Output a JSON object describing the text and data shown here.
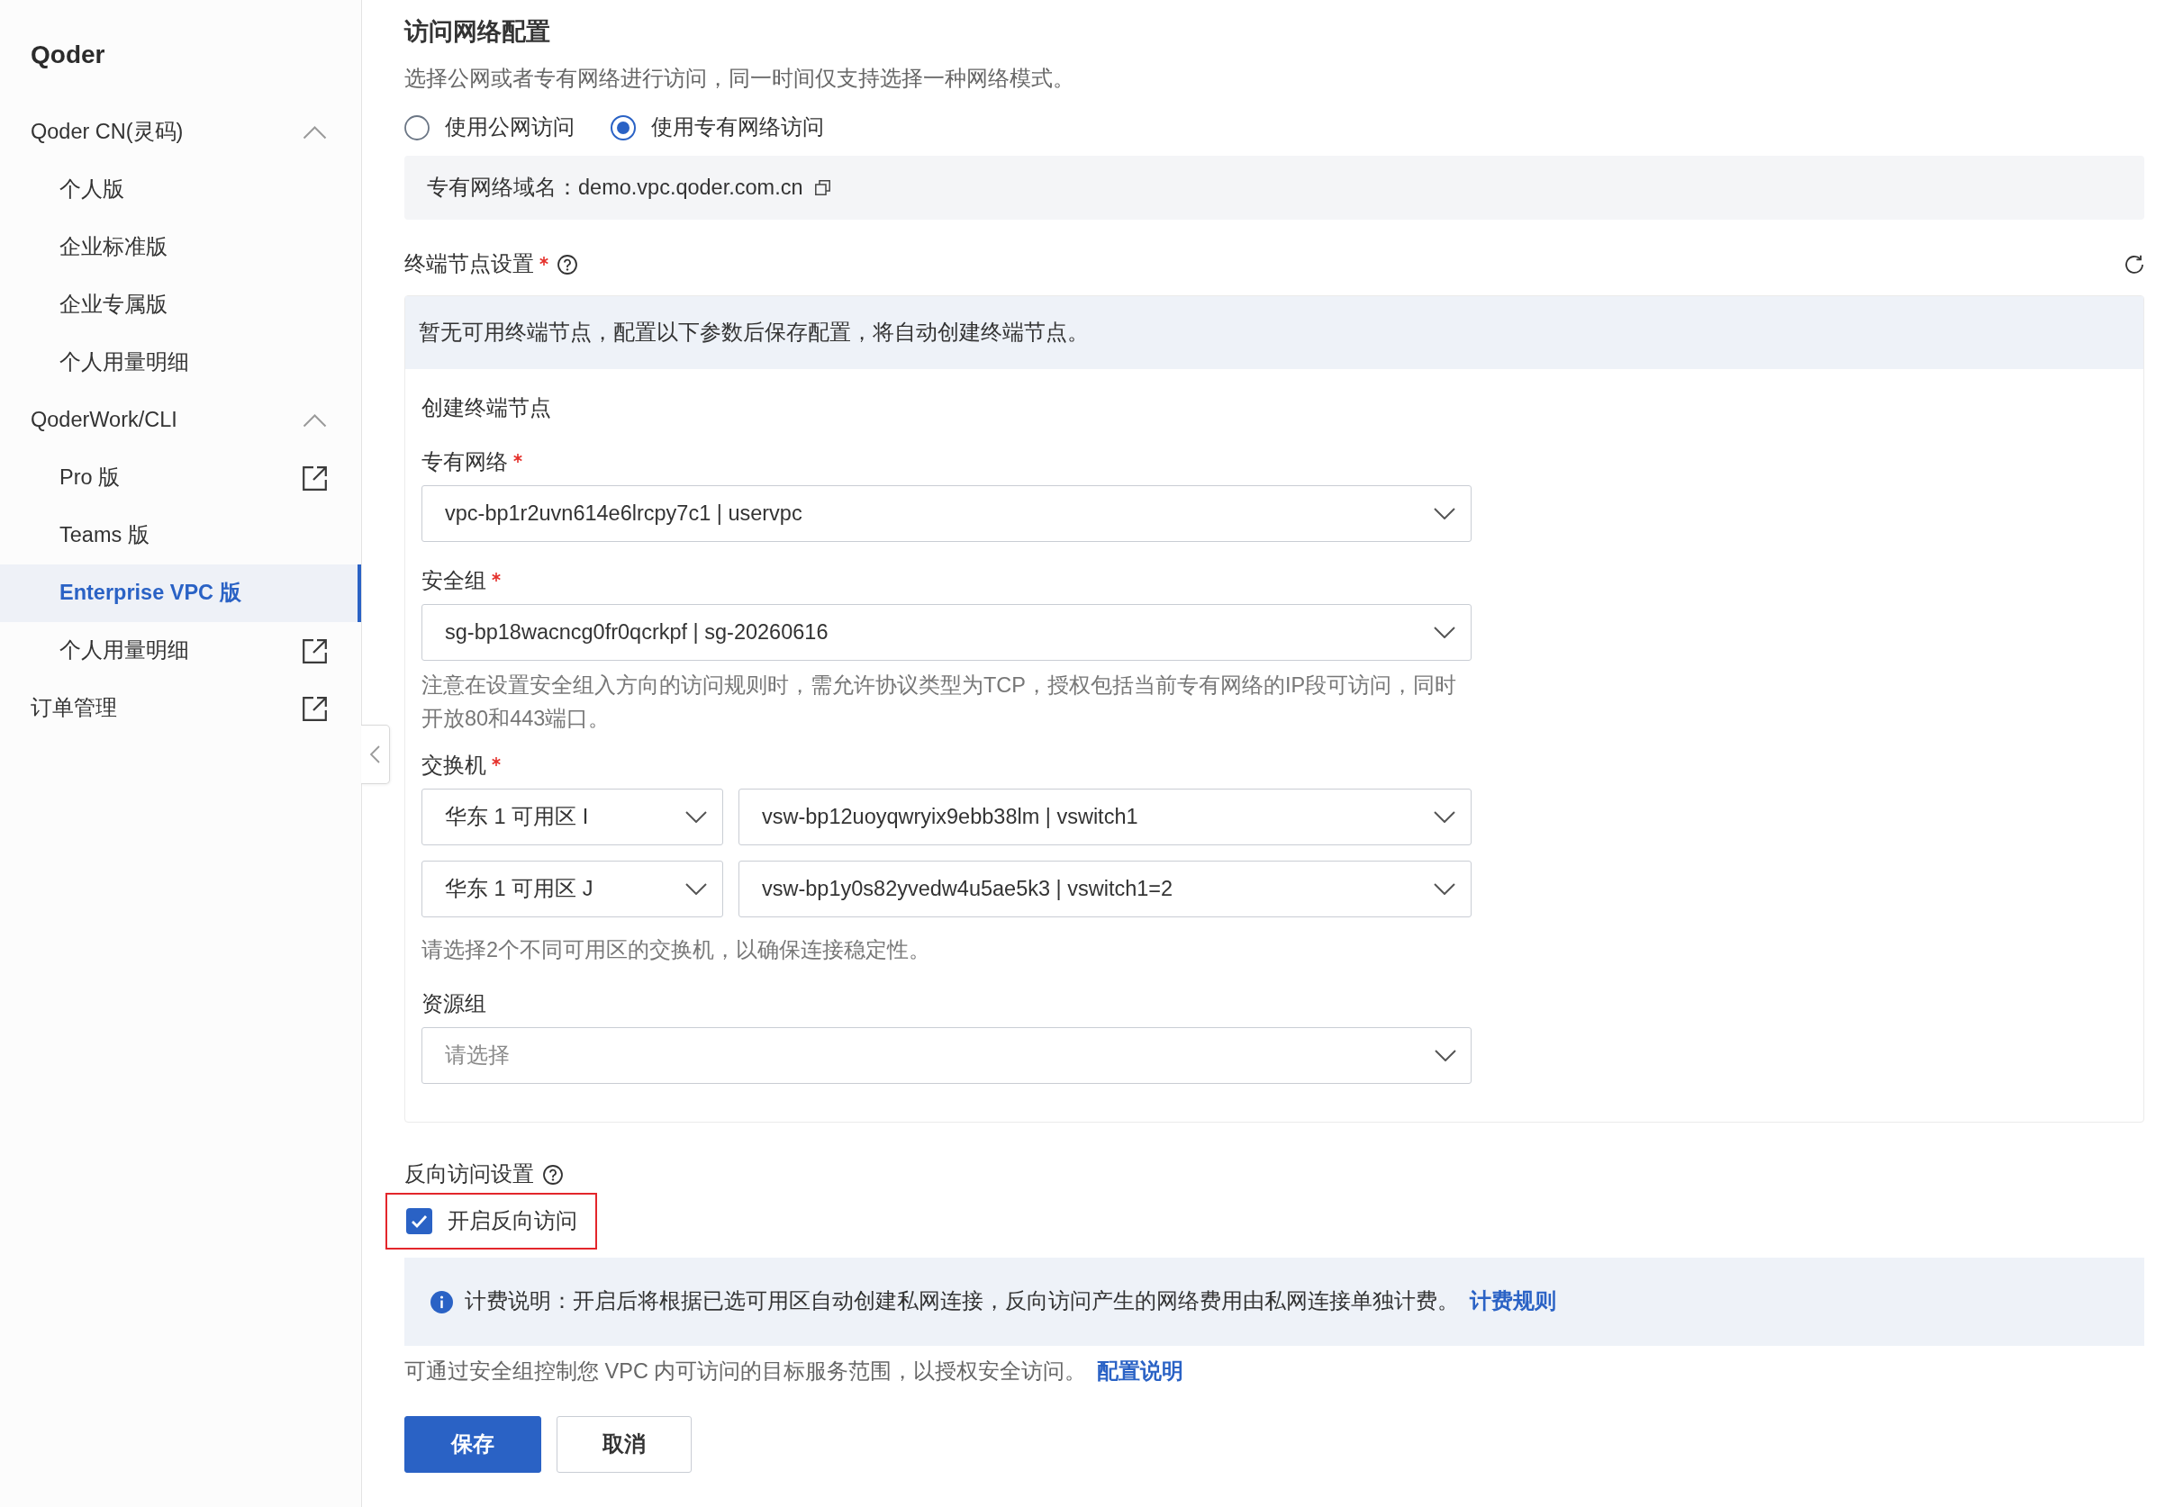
{
  "sidebar": {
    "title": "Qoder",
    "items": [
      {
        "kind": "group",
        "label": "Qoder CN(灵码)",
        "expanded": true,
        "selected": false,
        "children": [
          {
            "label": "个人版",
            "selected": false,
            "external": false
          },
          {
            "label": "企业标准版",
            "selected": false,
            "external": false
          },
          {
            "label": "企业专属版",
            "selected": false,
            "external": false
          },
          {
            "label": "个人用量明细",
            "selected": false,
            "external": false
          }
        ]
      },
      {
        "kind": "group",
        "label": "QoderWork/CLI",
        "expanded": true,
        "selected": false,
        "children": [
          {
            "label": "Pro 版",
            "selected": false,
            "external": true
          },
          {
            "label": "Teams 版",
            "selected": false,
            "external": false
          },
          {
            "label": "Enterprise VPC 版",
            "selected": true,
            "external": false
          },
          {
            "label": "个人用量明细",
            "selected": false,
            "external": true
          }
        ]
      },
      {
        "kind": "link",
        "label": "订单管理",
        "selected": false,
        "external": true
      }
    ]
  },
  "network": {
    "title": "访问网络配置",
    "description": "选择公网或者专有网络进行访问，同一时间仅支持选择一种网络模式。",
    "modes": [
      {
        "label": "使用公网访问",
        "selected": false
      },
      {
        "label": "使用专有网络访问",
        "selected": true
      }
    ],
    "domain": {
      "label": "专有网络域名：",
      "value": "demo.vpc.qoder.com.cn"
    }
  },
  "endpoint": {
    "label": "终端节点设置",
    "required": true,
    "notice": "暂无可用终端节点，配置以下参数后保存配置，将自动创建终端节点。",
    "create_title": "创建终端节点",
    "fields": [
      {
        "kind": "select",
        "label": "专有网络",
        "required": true,
        "value": "vpc-bp1r2uvn614e6lrcpy7c1 | uservpc"
      },
      {
        "kind": "select",
        "label": "安全组",
        "required": true,
        "value": "sg-bp18wacncg0fr0qcrkpf | sg-20260616",
        "hint": "注意在设置安全组入方向的访问规则时，需允许协议类型为TCP，授权包括当前专有网络的IP段可访问，同时开放80和443端口。"
      },
      {
        "kind": "select_pairs",
        "label": "交换机",
        "required": true,
        "rows": [
          {
            "zone": "华东 1 可用区 I",
            "vswitch": "vsw-bp12uoyqwryix9ebb38lm | vswitch1"
          },
          {
            "zone": "华东 1 可用区 J",
            "vswitch": "vsw-bp1y0s82yvedw4u5ae5k3 | vswitch1=2"
          }
        ],
        "hint": "请选择2个不同可用区的交换机，以确保连接稳定性。"
      },
      {
        "kind": "select",
        "label": "资源组",
        "required": false,
        "placeholder": "请选择"
      }
    ]
  },
  "reverse_access": {
    "label": "反向访问设置",
    "option": {
      "label": "开启反向访问",
      "checked": true,
      "highlighted": true
    },
    "billing_note": {
      "text": "计费说明：开启后将根据已选可用区自动创建私网连接，反向访问产生的网络费用由私网连接单独计费。",
      "link": "计费规则"
    },
    "footnote": {
      "text": "可通过安全组控制您 VPC 内可访问的目标服务范围，以授权安全访问。",
      "link": "配置说明"
    }
  },
  "buttons": [
    {
      "label": "保存",
      "kind": "primary"
    },
    {
      "label": "取消",
      "kind": "secondary"
    }
  ]
}
